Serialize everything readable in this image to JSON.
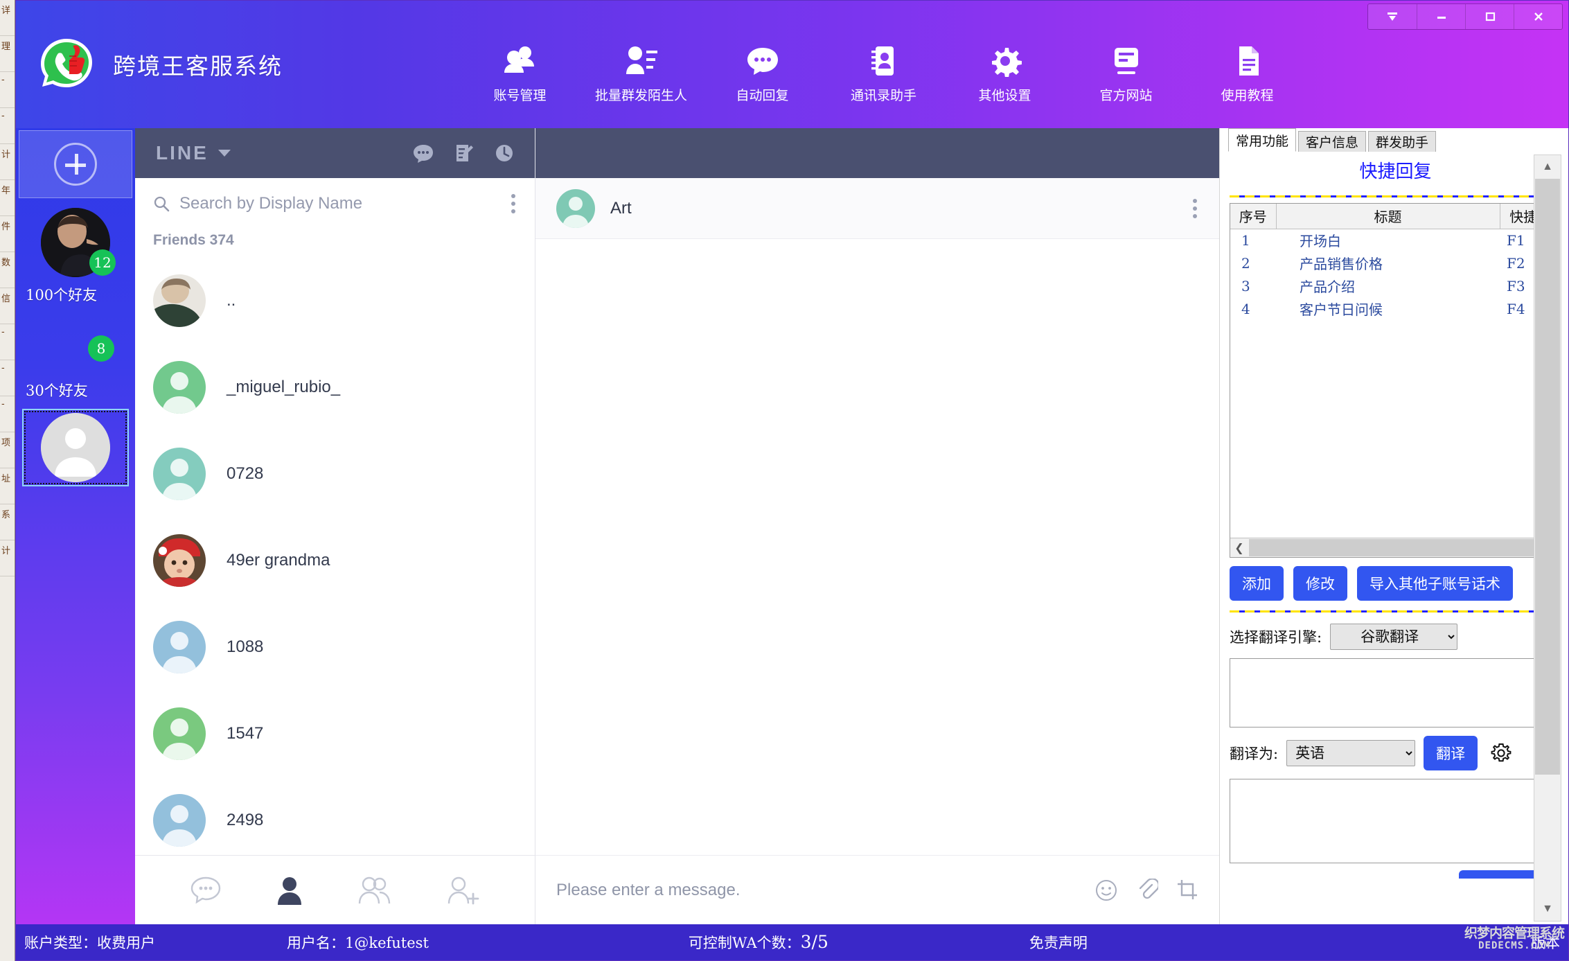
{
  "window": {
    "controls": [
      {
        "name": "collapse-button",
        "glyph": "▼"
      },
      {
        "name": "minimize-button",
        "glyph": "—"
      },
      {
        "name": "maximize-button",
        "glyph": "□"
      },
      {
        "name": "close-button",
        "glyph": "✕"
      }
    ]
  },
  "brand": {
    "title": "跨境王客服系统",
    "logo_icon": "whatsapp-thumbsup-logo"
  },
  "topnav": [
    {
      "label": "账号管理",
      "icon": "users-group-icon"
    },
    {
      "label": "批量群发陌生人",
      "icon": "person-list-icon"
    },
    {
      "label": "自动回复",
      "icon": "chat-bubble-dots-icon"
    },
    {
      "label": "通讯录助手",
      "icon": "contact-card-icon"
    },
    {
      "label": "其他设置",
      "icon": "gear-icon"
    },
    {
      "label": "官方网站",
      "icon": "window-list-icon"
    },
    {
      "label": "使用教程",
      "icon": "document-text-icon"
    }
  ],
  "rail": {
    "add_account_icon": "circle-plus-icon",
    "accounts": [
      {
        "name": "100个好友",
        "badge": "12",
        "avatar": "photo-avatar-man"
      },
      {
        "name": "30个好友",
        "badge": "8",
        "avatar": "blank-avatar"
      },
      {
        "name": "",
        "badge": "",
        "avatar": "default-person-avatar",
        "selected": true
      }
    ]
  },
  "contacts": {
    "platform": "LINE",
    "platform_caret_icon": "chevron-down-icon",
    "header_icons": [
      {
        "name": "chat-bubble-dots-icon"
      },
      {
        "name": "compose-note-icon"
      },
      {
        "name": "clock-history-icon"
      }
    ],
    "search": {
      "placeholder": "Search by Display Name",
      "value": "",
      "icon": "search-icon"
    },
    "more_icon": "more-vertical-icon",
    "friends_label": "Friends 374",
    "items": [
      {
        "name": "..",
        "avatar_color": "#cfd4d8",
        "avatar": "photo-avatar-girl"
      },
      {
        "name": "_miguel_rubio_",
        "avatar_color": "#72c98d",
        "avatar": "person-silhouette"
      },
      {
        "name": "0728",
        "avatar_color": "#84ccbe",
        "avatar": "person-silhouette"
      },
      {
        "name": "49er grandma",
        "avatar_color": "#c4836f",
        "avatar": "photo-avatar-baby"
      },
      {
        "name": "1088",
        "avatar_color": "#93c0dc",
        "avatar": "person-silhouette"
      },
      {
        "name": "1547",
        "avatar_color": "#7ac97f",
        "avatar": "person-silhouette"
      },
      {
        "name": "2498",
        "avatar_color": "#93c0dc",
        "avatar": "person-silhouette"
      }
    ],
    "toolbar": [
      {
        "name": "chats-tab",
        "icon": "chat-bubble-dots-icon",
        "active": false
      },
      {
        "name": "friends-tab",
        "icon": "person-filled-icon",
        "active": true
      },
      {
        "name": "groups-tab",
        "icon": "people-group-icon",
        "active": false
      },
      {
        "name": "add-friend-tab",
        "icon": "person-plus-icon",
        "active": false
      }
    ]
  },
  "chat": {
    "contact_name": "Art",
    "avatar_color": "#7fc9b4",
    "more_icon": "more-vertical-icon",
    "input_placeholder": "Please enter a message.",
    "input_value": "",
    "input_icons": [
      {
        "name": "emoji-icon"
      },
      {
        "name": "attachment-clip-icon"
      },
      {
        "name": "crop-screenshot-icon"
      }
    ]
  },
  "right_panel": {
    "tabs": [
      {
        "label": "常用功能",
        "active": true
      },
      {
        "label": "客户信息",
        "active": false
      },
      {
        "label": "群发助手",
        "active": false
      }
    ],
    "section_title": "快捷回复",
    "table": {
      "columns": [
        "序号",
        "标题",
        "快捷键"
      ],
      "rows": [
        [
          "1",
          "开场白",
          "F1"
        ],
        [
          "2",
          "产品销售价格",
          "F2"
        ],
        [
          "3",
          "产品介绍",
          "F3"
        ],
        [
          "4",
          "客户节日问候",
          "F4"
        ]
      ]
    },
    "hscroll": {
      "left_icon": "chevron-left-icon",
      "right_icon": "chevron-right-icon"
    },
    "buttons": [
      {
        "label": "添加",
        "name": "add-button"
      },
      {
        "label": "修改",
        "name": "edit-button"
      },
      {
        "label": "导入其他子账号话术",
        "name": "import-other-subaccount-button"
      }
    ],
    "engine_label": "选择翻译引擎:",
    "engine_value": "谷歌翻译",
    "engine_options": [
      "谷歌翻译"
    ],
    "source_text": "",
    "translate_to_label": "翻译为:",
    "translate_to_value": "英语",
    "translate_to_options": [
      "英语"
    ],
    "translate_button": "翻译",
    "settings_icon": "gear-outline-icon",
    "result_text": "",
    "vscroll": {
      "up_icon": "chevron-up-icon",
      "down_icon": "chevron-down-icon"
    }
  },
  "statusbar": {
    "account_type": "账户类型：收费用户",
    "username": "用户名：1@kefutest",
    "wa_count_label": "可控制WA个数：",
    "wa_count_value": "3/5",
    "disclaimer": "免责声明",
    "version": "版本",
    "watermark_line1": "织梦内容管理系统",
    "watermark_line2": "DEDECMS.COM"
  },
  "background_window": {
    "rows": [
      "详",
      "理",
      "-",
      "-",
      "计",
      "年",
      "件",
      "数",
      "信",
      "-",
      "-",
      "-",
      "项",
      "址",
      "系",
      "计"
    ]
  }
}
